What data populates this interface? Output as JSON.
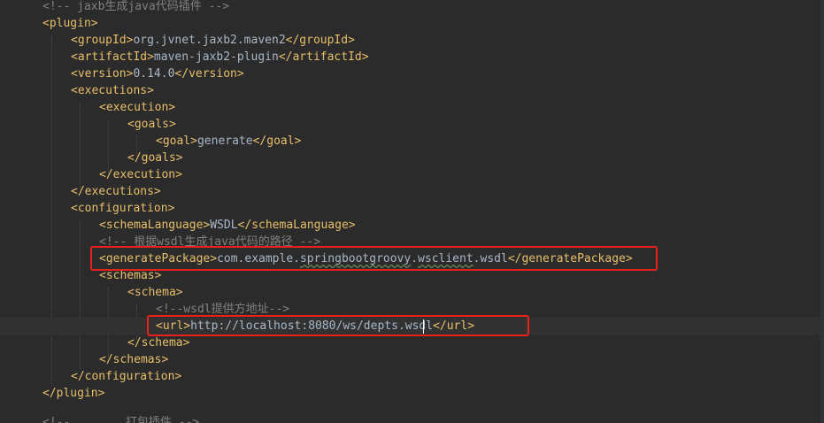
{
  "editor": {
    "lines": {
      "l0": "<!-- jaxb生成java代码插件 -->",
      "l1": "<plugin>",
      "l2": {
        "open": "<groupId>",
        "value": "org.jvnet.jaxb2.maven2",
        "close": "</groupId>"
      },
      "l3": {
        "open": "<artifactId>",
        "value": "maven-jaxb2-plugin",
        "close": "</artifactId>"
      },
      "l4": {
        "open": "<version>",
        "value": "0.14.0",
        "close": "</version>"
      },
      "l5": "<executions>",
      "l6": "<execution>",
      "l7": "<goals>",
      "l8": {
        "open": "<goal>",
        "value": "generate",
        "close": "</goal>"
      },
      "l9": "</goals>",
      "l10": "</execution>",
      "l11": "</executions>",
      "l12": "<configuration>",
      "l13": {
        "open": "<schemaLanguage>",
        "value": "WSDL",
        "close": "</schemaLanguage>"
      },
      "l14": "<!-- 根据wsdl生成java代码的路径 -->",
      "l15": {
        "open": "<generatePackage>",
        "value_a": "com.example.",
        "value_b": "springbootgroovy",
        "value_c": ".",
        "value_d": "wsclient",
        "value_e": ".wsdl",
        "close": "</generatePackage>"
      },
      "l16": "<schemas>",
      "l17": "<schema>",
      "l18": "<!--wsdl提供方地址-->",
      "l19": {
        "open": "<url>",
        "value": "http://localhost:8080/ws/depts.wsdl",
        "close": "</url>"
      },
      "l20": "</schema>",
      "l21": "</schemas>",
      "l22": "</configuration>",
      "l23": "</plugin>",
      "l25": "<!-- ...... 打包插件 -->"
    }
  },
  "colors": {
    "background": "#2b2b2b",
    "tag": "#e8bf6a",
    "text": "#a9b7c6",
    "comment": "#808080",
    "highlight_box": "#e8211d"
  }
}
